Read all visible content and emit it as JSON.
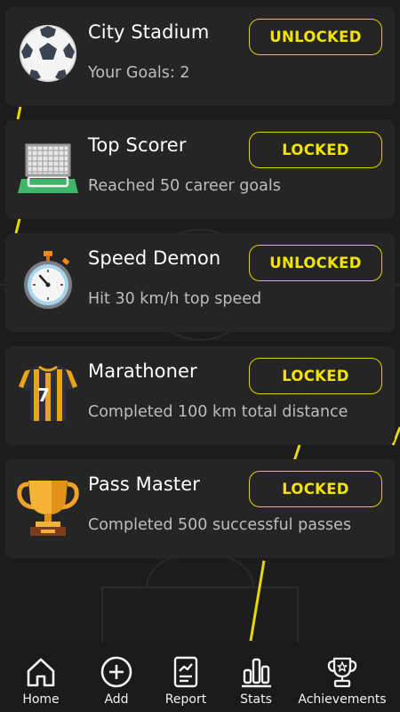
{
  "colors": {
    "accent": "#f2e400",
    "card": "#252525",
    "background": "#1c1c1c"
  },
  "achievements": [
    {
      "icon": "soccer-ball-icon",
      "title": "City Stadium",
      "description": "Your Goals: 2",
      "status": "UNLOCKED"
    },
    {
      "icon": "soccer-goal-icon",
      "title": "Top Scorer",
      "description": "Reached 50 career goals",
      "status": "LOCKED"
    },
    {
      "icon": "stopwatch-icon",
      "title": "Speed Demon",
      "description": "Hit 30 km/h top speed",
      "status": "UNLOCKED"
    },
    {
      "icon": "jersey-icon",
      "title": "Marathoner",
      "description": "Completed 100 km total distance",
      "status": "LOCKED"
    },
    {
      "icon": "trophy-icon",
      "title": "Pass Master",
      "description": "Completed 500 successful passes",
      "status": "LOCKED"
    }
  ],
  "nav": {
    "items": [
      {
        "icon": "home-icon",
        "label": "Home"
      },
      {
        "icon": "add-circle-icon",
        "label": "Add"
      },
      {
        "icon": "report-icon",
        "label": "Report"
      },
      {
        "icon": "stats-icon",
        "label": "Stats"
      },
      {
        "icon": "achievements-icon",
        "label": "Achievements"
      }
    ]
  },
  "jersey_number": "7"
}
